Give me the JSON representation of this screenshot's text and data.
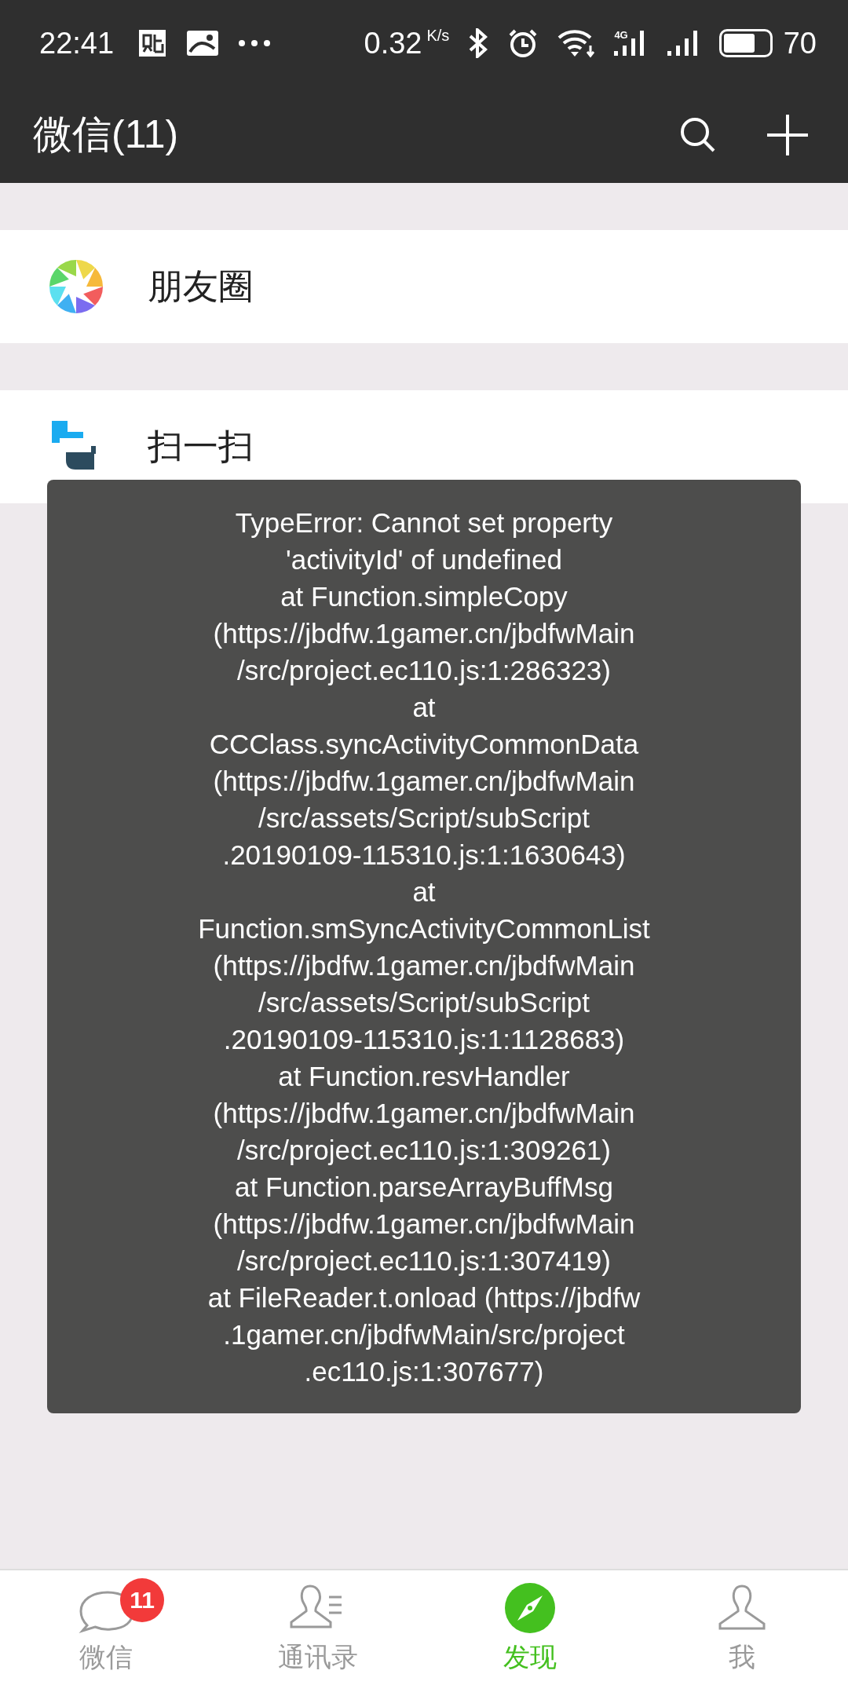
{
  "status_bar": {
    "time": "22:41",
    "speed": "0.32",
    "speed_unit": "K/s",
    "network": "4G",
    "battery": "70"
  },
  "header": {
    "title": "微信(11)"
  },
  "menu_items": [
    {
      "label": "朋友圈",
      "kind": "moments"
    },
    {
      "label": "扫一扫",
      "kind": "scan"
    }
  ],
  "toast": {
    "lines": [
      "TypeError: Cannot set property",
      "'activityId' of undefined",
      "at Function.simpleCopy",
      "(https://jbdfw.1gamer.cn/jbdfwMain",
      "/src/project.ec110.js:1:286323)",
      "at",
      "CCClass.syncActivityCommonData",
      "(https://jbdfw.1gamer.cn/jbdfwMain",
      "/src/assets/Script/subScript",
      ".20190109-115310.js:1:1630643)",
      "at",
      "Function.smSyncActivityCommonList",
      "(https://jbdfw.1gamer.cn/jbdfwMain",
      "/src/assets/Script/subScript",
      ".20190109-115310.js:1:1128683)",
      "at Function.resvHandler",
      "(https://jbdfw.1gamer.cn/jbdfwMain",
      "/src/project.ec110.js:1:309261)",
      "at Function.parseArrayBuffMsg",
      "(https://jbdfw.1gamer.cn/jbdfwMain",
      "/src/project.ec110.js:1:307419)",
      "at FileReader.t.onload (https://jbdfw",
      ".1gamer.cn/jbdfwMain/src/project",
      ".ec110.js:1:307677)"
    ]
  },
  "tabs": [
    {
      "label": "微信",
      "kind": "chats",
      "selected": false,
      "badge": "11"
    },
    {
      "label": "通讯录",
      "kind": "contacts",
      "selected": false
    },
    {
      "label": "发现",
      "kind": "discover",
      "selected": true
    },
    {
      "label": "我",
      "kind": "me",
      "selected": false
    }
  ]
}
